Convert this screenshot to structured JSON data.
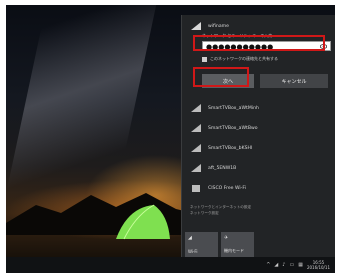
{
  "network_panel": {
    "selected_network": "wifiname",
    "password_prompt": "ネットワーク セキュリティ キーの入力",
    "password_value": "●●●●●●●●●●●",
    "share_checkbox_label": "このネットワークの連絡先と共有する",
    "next_button": "次へ",
    "cancel_button": "キャンセル",
    "networks": [
      "SmartTVBox_aWtMinh",
      "SmartTVBox_aWtBwo",
      "SmartTVBox_bKSHI",
      "aft_5ENW1B",
      "CISCO Free Wi-Fi"
    ],
    "settings_link": "ネットワークとインターネットの設定",
    "settings_sub": "ネットワーク設定",
    "quick_tiles": [
      "Wi-Fi",
      "機内モード"
    ]
  },
  "taskbar": {
    "tray_icons": [
      "chevron-up-icon",
      "network-icon",
      "volume-icon",
      "battery-icon",
      "keyboard-icon"
    ],
    "time": "16:55",
    "date": "2016/10/11"
  },
  "colors": {
    "panel_bg": "#222426",
    "highlight_red": "#d01818",
    "taskbar_bg": "#101214"
  }
}
